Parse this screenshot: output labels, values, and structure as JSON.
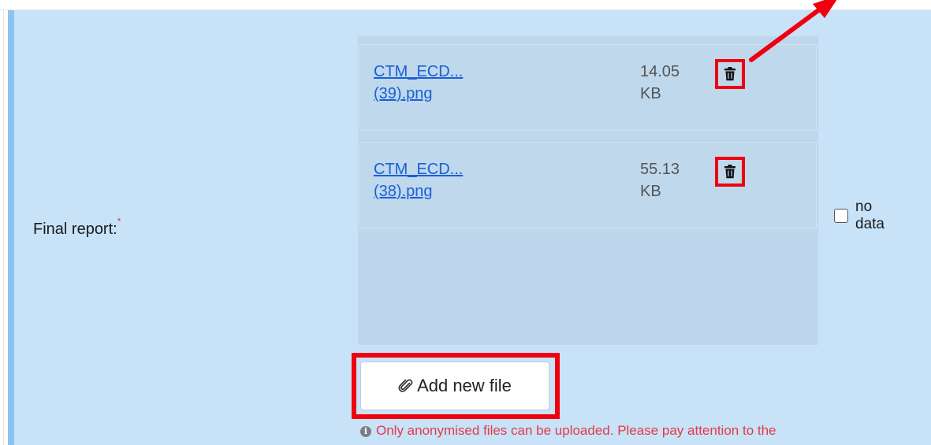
{
  "field": {
    "label": "Final report:",
    "required_mark": "*"
  },
  "files": [
    {
      "name_line1": "CTM_ECD...",
      "name_line2": "(39).png",
      "size_value": "14.05",
      "size_unit": "KB",
      "delete_icon": "trash-icon"
    },
    {
      "name_line1": "CTM_ECD...",
      "name_line2": "(38).png",
      "size_value": "55.13",
      "size_unit": "KB",
      "delete_icon": "trash-icon"
    }
  ],
  "no_data": {
    "checked": false,
    "label_line1": "no",
    "label_line2": "data"
  },
  "add_button": {
    "label": "Add new file",
    "icon": "paperclip-icon"
  },
  "note": {
    "icon": "info-icon",
    "text": "Only anonymised files can be uploaded. Please pay attention to the"
  },
  "colors": {
    "highlight": "#f0000e",
    "row_background": "#c8e2f8",
    "link": "#1b5fd6",
    "warning_text": "#e63946"
  }
}
